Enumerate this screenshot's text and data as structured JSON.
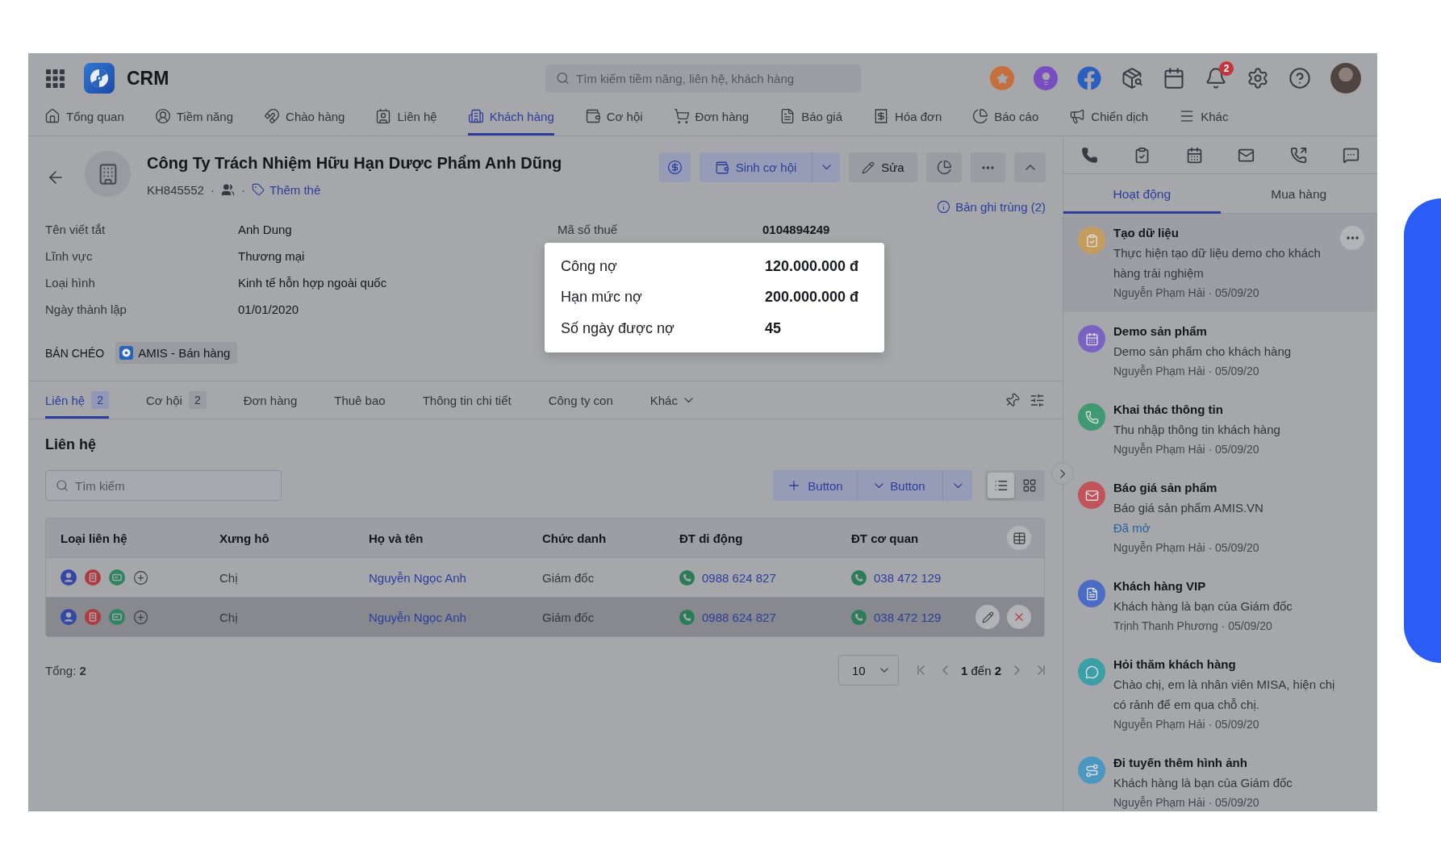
{
  "topbar": {
    "app_name": "CRM",
    "search": {
      "placeholder": "Tìm kiếm tiềm năng, liên hệ, khách hàng"
    },
    "notification_count": "2"
  },
  "nav": [
    {
      "label": "Tổng quan",
      "selected": false
    },
    {
      "label": "Tiềm năng",
      "selected": false
    },
    {
      "label": "Chào hàng",
      "selected": false
    },
    {
      "label": "Liên hệ",
      "selected": false
    },
    {
      "label": "Khách hàng",
      "selected": true
    },
    {
      "label": "Cơ hội",
      "selected": false
    },
    {
      "label": "Đơn hàng",
      "selected": false
    },
    {
      "label": "Báo giá",
      "selected": false
    },
    {
      "label": "Hóa đơn",
      "selected": false
    },
    {
      "label": "Báo cáo",
      "selected": false
    },
    {
      "label": "Chiến dịch",
      "selected": false
    },
    {
      "label": "Khác",
      "selected": false
    }
  ],
  "record": {
    "title": "Công Ty Trách Nhiệm Hữu Hạn Dược Phẩm Anh Dũng",
    "code": "KH845552",
    "dots": [
      "·",
      "·"
    ],
    "add_tag": "Thêm thẻ",
    "actions": {
      "create_opportunity": "Sinh cơ hội",
      "edit": "Sửa"
    },
    "duplicates": "Bản ghi trùng (2)",
    "fields_left": [
      {
        "label": "Tên viết tắt",
        "value": "Anh Dung"
      },
      {
        "label": "Lĩnh vực",
        "value": "Thương mại"
      },
      {
        "label": "Loại hình",
        "value": "Kinh tế hỗn hợp ngoài quốc"
      },
      {
        "label": "Ngày thành lập",
        "value": "01/01/2020"
      }
    ],
    "fields_right": [
      {
        "label": "Mã số thuế",
        "value": "0104894249"
      }
    ],
    "cross_sell": {
      "label": "BÁN CHÉO",
      "app": "AMIS - Bán hàng"
    }
  },
  "debt_popup": [
    {
      "label": "Công nợ",
      "value": "120.000.000 đ"
    },
    {
      "label": "Hạn mức nợ",
      "value": "200.000.000 đ"
    },
    {
      "label": "Số ngày được nợ",
      "value": "45"
    }
  ],
  "detail_tabs": [
    {
      "label": "Liên hệ",
      "count": "2",
      "selected": true,
      "dropdown": false
    },
    {
      "label": "Cơ hội",
      "count": "2",
      "selected": false,
      "dropdown": false
    },
    {
      "label": "Đơn hàng",
      "selected": false,
      "dropdown": false
    },
    {
      "label": "Thuê bao",
      "selected": false,
      "dropdown": false
    },
    {
      "label": "Thông tin chi tiết",
      "selected": false,
      "dropdown": false
    },
    {
      "label": "Công ty con",
      "selected": false,
      "dropdown": false
    },
    {
      "label": "Khác",
      "selected": false,
      "dropdown": true
    }
  ],
  "contacts": {
    "title": "Liên hệ",
    "search": {
      "placeholder": "Tìm kiếm"
    },
    "add_button": "Button",
    "more_button": "Button",
    "view_modes": [
      {
        "kind": "list",
        "selected": true
      },
      {
        "kind": "grid",
        "selected": false
      }
    ],
    "table": {
      "columns": [
        "Loại liên hệ",
        "Xưng hô",
        "Họ và tên",
        "Chức danh",
        "ĐT di động",
        "ĐT cơ quan"
      ],
      "rows": [
        {
          "salutation": "Chị",
          "name": "Nguyễn Ngọc Anh",
          "job_title": "Giám đốc",
          "mobile": "0988 624 827",
          "office": "038 472 129",
          "hovered": false
        },
        {
          "salutation": "Chị",
          "name": "Nguyễn Ngọc Anh",
          "job_title": "Giám đốc",
          "mobile": "0988 624 827",
          "office": "038 472 129",
          "hovered": true
        }
      ]
    },
    "total": "Tổng: **2**",
    "page_size": "10",
    "page_info": "**1** đến **2**"
  },
  "activity_panel": {
    "tabs": [
      {
        "label": "Hoạt động",
        "selected": true
      },
      {
        "label": "Mua hàng",
        "selected": false
      }
    ],
    "items": [
      {
        "kind": "task",
        "color": "#c49d5e",
        "title": "Tạo dữ liệu",
        "description": "Thực hiện tạo dữ liệu demo cho khách hàng trải nghiệm",
        "meta": "Nguyễn Phạm Hải · 05/09/20",
        "hovered": true
      },
      {
        "kind": "event",
        "color": "#7a62c2",
        "title": "Demo sản phẩm",
        "description": "Demo sản phẩm cho khách hàng",
        "meta": "Nguyễn Phạm Hải · 05/09/20",
        "hovered": false
      },
      {
        "kind": "call",
        "color": "#3f9a72",
        "title": "Khai thác thông tin",
        "description": "Thu nhập thông tin khách hàng",
        "meta": "Nguyễn Phạm Hải · 05/09/20",
        "hovered": false
      },
      {
        "kind": "email",
        "color": "#c2535b",
        "title": "Báo giá sản phẩm",
        "description": "Báo giá sản phẩm AMIS.VN",
        "status": "Đã mở",
        "meta": "Nguyễn Phạm Hải · 05/09/20",
        "hovered": false
      },
      {
        "kind": "note",
        "color": "#4a6cc4",
        "title": "Khách hàng VIP",
        "description": "Khách hàng là bạn của Giám đốc",
        "meta": "Trịnh Thanh Phương · 05/09/20",
        "hovered": false
      },
      {
        "kind": "chat",
        "color": "#3aa0a6",
        "title": "Hỏi thăm khách hàng",
        "description": "Chào chị, em là nhân viên MISA, hiện chị có rảnh để em qua chỗ chị.",
        "meta": "Nguyễn Phạm Hải · 05/09/20",
        "hovered": false
      },
      {
        "kind": "route",
        "color": "#4b97c2",
        "title": "Đi tuyến thêm hình ảnh",
        "description": "Khách hàng là bạn của Giám đốc",
        "meta": "Nguyễn Phạm Hải · 05/09/20",
        "hovered": false
      }
    ]
  }
}
